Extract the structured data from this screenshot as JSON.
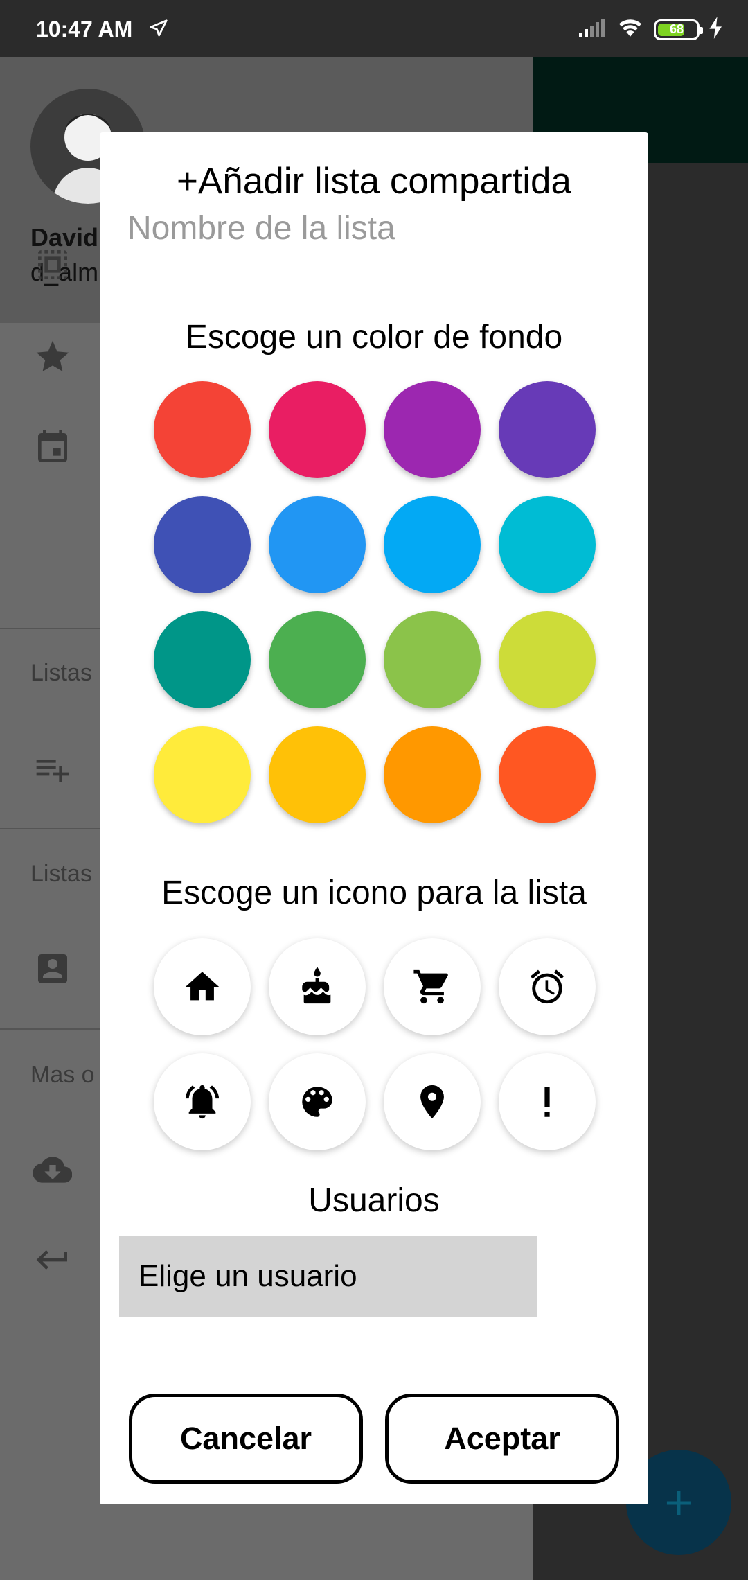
{
  "status_bar": {
    "time": "10:47 AM",
    "battery": "68"
  },
  "drawer": {
    "user_name": "David",
    "user_handle": "d_alm",
    "section_1": "Listas",
    "section_2": "Listas",
    "section_3": "Mas o"
  },
  "dialog": {
    "title": "+Añadir lista compartida",
    "name_placeholder": "Nombre de la lista",
    "color_heading": "Escoge un color de fondo",
    "colors": [
      "#f44336",
      "#e91e63",
      "#9c27b0",
      "#673ab7",
      "#3f51b5",
      "#2196f3",
      "#03a9f4",
      "#00bcd4",
      "#009688",
      "#4caf50",
      "#8bc34a",
      "#cddc39",
      "#ffeb3b",
      "#ffc107",
      "#ff9800",
      "#ff5722"
    ],
    "icon_heading": "Escoge un icono para la lista",
    "icons": [
      "home-icon",
      "cake-icon",
      "shopping-cart-icon",
      "alarm-icon",
      "notification-bell-icon",
      "palette-icon",
      "location-pin-icon",
      "exclamation-icon"
    ],
    "users_heading": "Usuarios",
    "user_select": "Elige un usuario",
    "cancel": "Cancelar",
    "accept": "Aceptar"
  }
}
